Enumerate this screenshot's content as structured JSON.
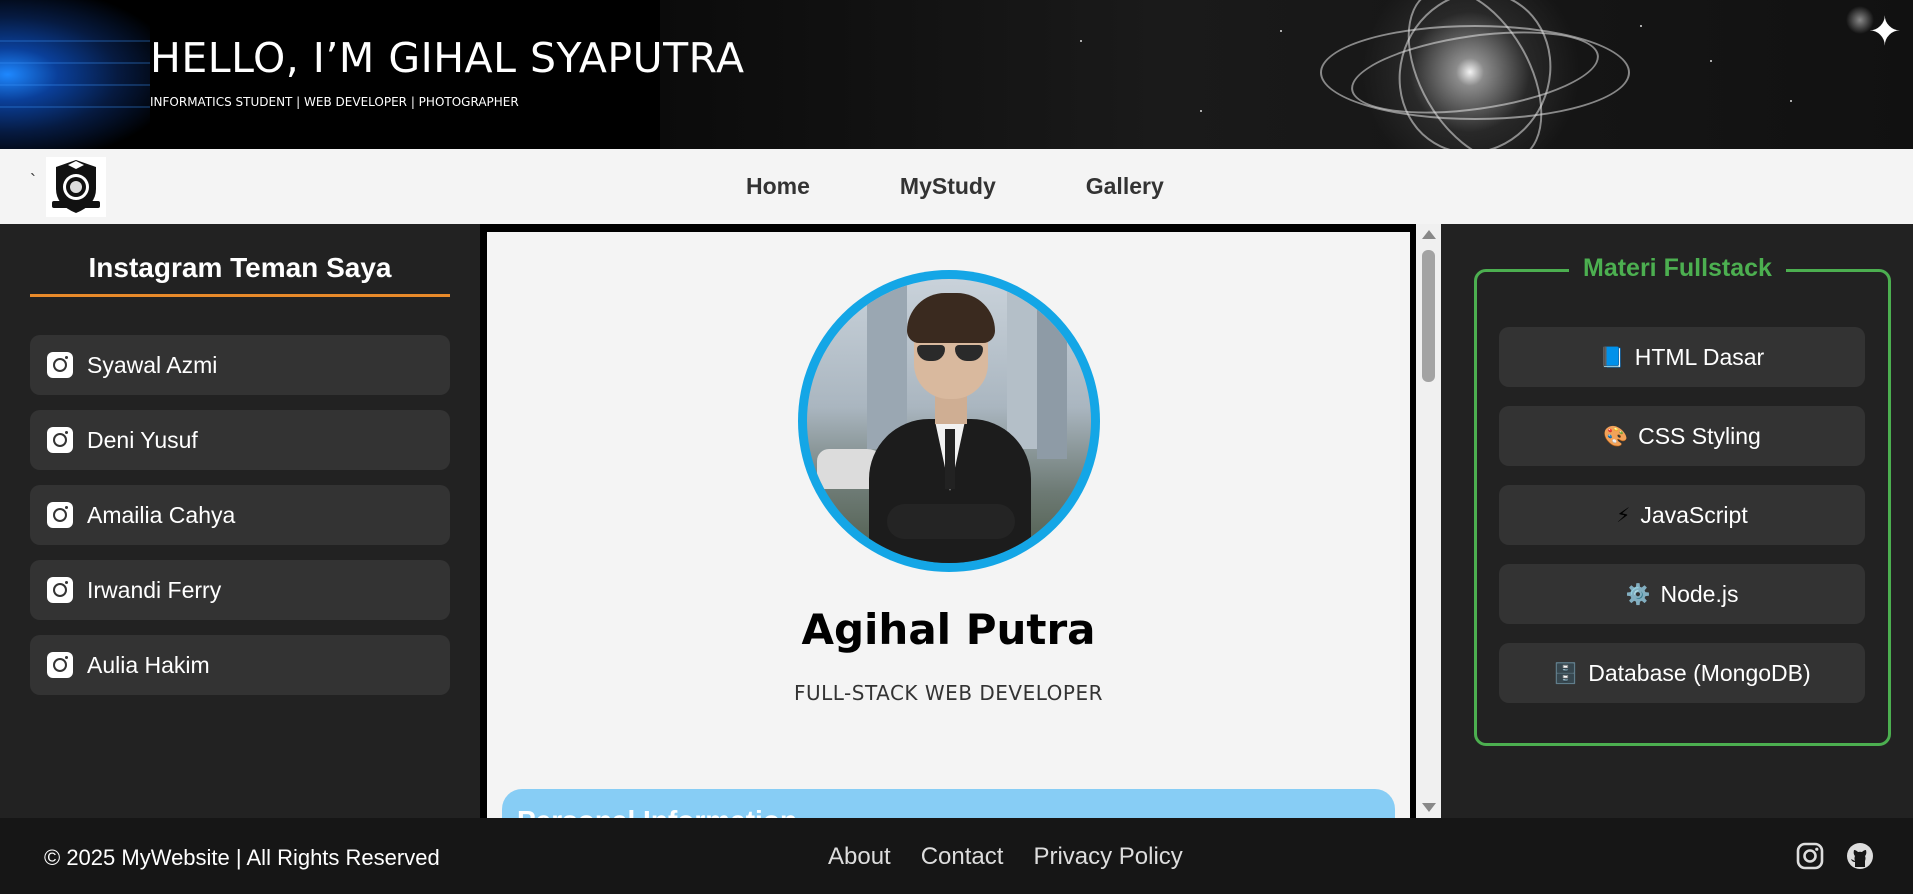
{
  "banner": {
    "title": "HELLO, I’M GIHAL SYAPUTRA",
    "subtitle": "INFORMATICS STUDENT | WEB DEVELOPER | PHOTOGRAPHER"
  },
  "nav": {
    "tick": "`",
    "items": [
      {
        "label": "Home"
      },
      {
        "label": "MyStudy"
      },
      {
        "label": "Gallery"
      }
    ]
  },
  "left_sidebar": {
    "heading": "Instagram Teman Saya",
    "friends": [
      {
        "name": "Syawal Azmi",
        "icon": "instagram-icon"
      },
      {
        "name": "Deni Yusuf",
        "icon": "instagram-icon"
      },
      {
        "name": "Amailia Cahya",
        "icon": "instagram-icon"
      },
      {
        "name": "Irwandi Ferry",
        "icon": "instagram-icon"
      },
      {
        "name": "Aulia Hakim",
        "icon": "instagram-icon"
      }
    ]
  },
  "profile": {
    "name": "Agihal Putra",
    "role": "FULL-STACK WEB DEVELOPER",
    "section_heading": "Personal Information"
  },
  "right_sidebar": {
    "title": "Materi Fullstack",
    "items": [
      {
        "emoji": "📘",
        "label": "HTML Dasar"
      },
      {
        "emoji": "🎨",
        "label": "CSS Styling"
      },
      {
        "emoji": "⚡",
        "label": "JavaScript"
      },
      {
        "emoji": "⚙️",
        "label": "Node.js"
      },
      {
        "emoji": "🗄️",
        "label": "Database (MongoDB)"
      }
    ]
  },
  "footer": {
    "copyright": "© 2025 MyWebsite | All Rights Reserved",
    "links": [
      {
        "label": "About"
      },
      {
        "label": "Contact"
      },
      {
        "label": "Privacy Policy"
      }
    ],
    "social": [
      "instagram-icon",
      "github-icon"
    ]
  },
  "colors": {
    "accent_orange": "#e88a2a",
    "accent_green": "#4caf50",
    "avatar_ring": "#14a6e6",
    "section_blue": "#87cdf5"
  }
}
